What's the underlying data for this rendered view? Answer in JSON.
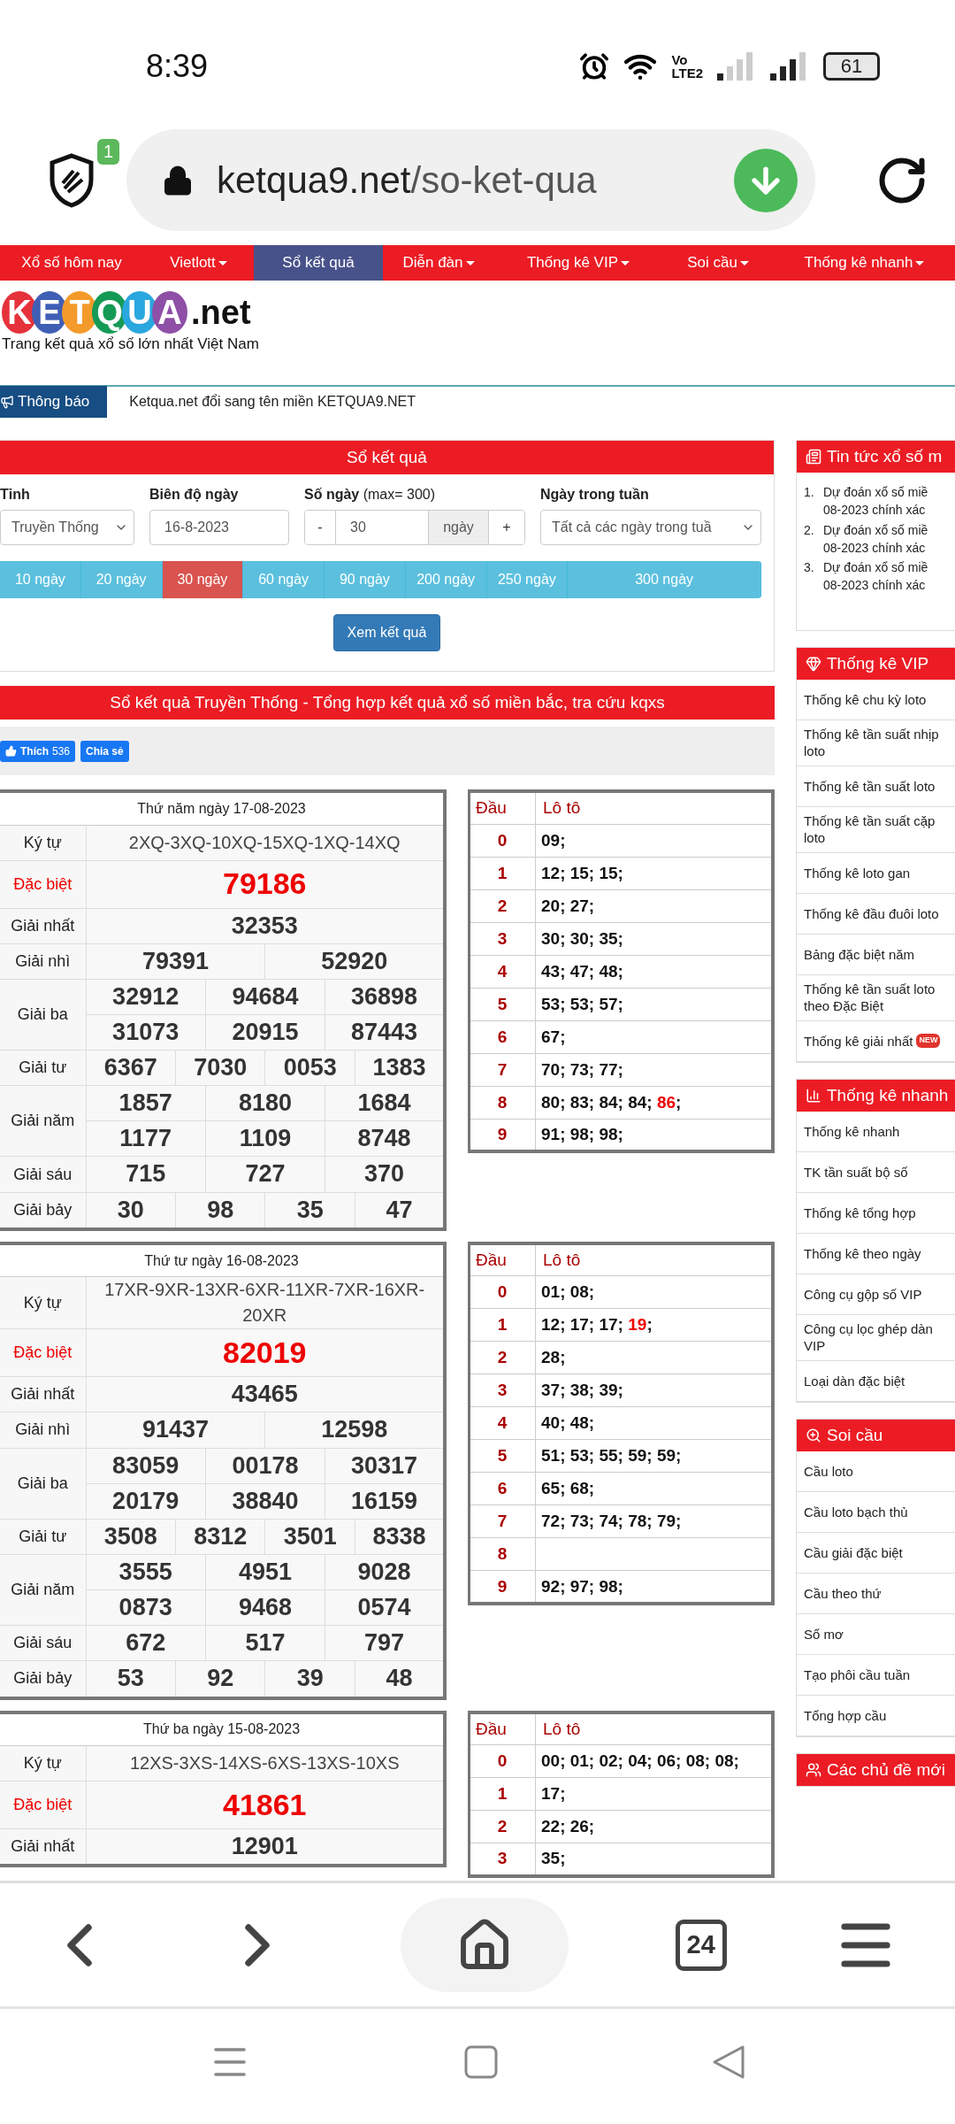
{
  "status_bar": {
    "time": "8:39",
    "volte": [
      "Vo",
      "LTE2"
    ],
    "battery": "61"
  },
  "browser": {
    "shield_badge": "1",
    "url_domain": "ketqua9.net",
    "url_path": "/so-ket-qua",
    "tab_count": "24"
  },
  "nav": [
    {
      "label": "Xổ số hôm nay",
      "has_menu": false,
      "selected": false
    },
    {
      "label": "Vietlott",
      "has_menu": true,
      "selected": false
    },
    {
      "label": "Sổ kết quả",
      "has_menu": false,
      "selected": true
    },
    {
      "label": "Diễn đàn",
      "has_menu": true,
      "selected": false
    },
    {
      "label": "Thống kê VIP",
      "has_menu": true,
      "selected": false
    },
    {
      "label": "Soi cầu",
      "has_menu": true,
      "selected": false
    },
    {
      "label": "Thống kê nhanh",
      "has_menu": true,
      "selected": false
    }
  ],
  "logo": {
    "letters": [
      {
        "char": "K",
        "color": "#e5323b"
      },
      {
        "char": "E",
        "color": "#3f5fb5"
      },
      {
        "char": "T",
        "color": "#f39a2b"
      },
      {
        "char": "Q",
        "color": "#159a55"
      },
      {
        "char": "U",
        "color": "#2aa7de"
      },
      {
        "char": "A",
        "color": "#8e4fa6"
      }
    ],
    "suffix": ".net",
    "tagline": "Trang kết quả xổ số lớn nhất Việt Nam"
  },
  "notice": {
    "label": "Thông báo",
    "text": "Ketqua.net đổi sang tên miền KETQUA9.NET"
  },
  "search_panel": {
    "title": "Sổ kết quả",
    "province": {
      "label": "Tỉnh",
      "value": "Truyền Thống"
    },
    "date_range": {
      "label": "Biên độ ngày",
      "value": "16-8-2023"
    },
    "days": {
      "label": "Số ngày",
      "hint": "(max= 300)",
      "minus": "-",
      "value": "30",
      "unit": "ngày",
      "plus": "+"
    },
    "weekday": {
      "label": "Ngày trong tuần",
      "value": "Tất cả các ngày trong tuầ"
    },
    "ranges": [
      {
        "label": "10 ngày",
        "selected": false
      },
      {
        "label": "20 ngày",
        "selected": false
      },
      {
        "label": "30 ngày",
        "selected": true
      },
      {
        "label": "60 ngày",
        "selected": false
      },
      {
        "label": "90 ngày",
        "selected": false
      },
      {
        "label": "200 ngày",
        "selected": false
      },
      {
        "label": "250 ngày",
        "selected": false
      },
      {
        "label": "300 ngày",
        "selected": false
      }
    ],
    "submit": "Xem kết quả"
  },
  "results_heading": "Sổ kết quả Truyền Thống - Tổng hợp kết quả xổ số miền bắc, tra cứu kqxs",
  "social": {
    "like": "Thích",
    "like_count": "536",
    "share": "Chia sẻ"
  },
  "draws": [
    {
      "date": "Thứ năm ngày 17-08-2023",
      "prizes": [
        {
          "kind": "code",
          "label": "Ký tự",
          "lines": [
            [
              "2XQ-3XQ-10XQ-15XQ-1XQ-14XQ"
            ]
          ]
        },
        {
          "kind": "special",
          "label": "Đặc biệt",
          "lines": [
            [
              "79186"
            ]
          ]
        },
        {
          "kind": "normal",
          "label": "Giải nhất",
          "lines": [
            [
              "32353"
            ]
          ]
        },
        {
          "kind": "normal",
          "label": "Giải nhì",
          "lines": [
            [
              "79391",
              "52920"
            ]
          ]
        },
        {
          "kind": "normal",
          "label": "Giải ba",
          "lines": [
            [
              "32912",
              "94684",
              "36898"
            ],
            [
              "31073",
              "20915",
              "87443"
            ]
          ]
        },
        {
          "kind": "normal",
          "label": "Giải tư",
          "lines": [
            [
              "6367",
              "7030",
              "0053",
              "1383"
            ]
          ]
        },
        {
          "kind": "normal",
          "label": "Giải năm",
          "lines": [
            [
              "1857",
              "8180",
              "1684"
            ],
            [
              "1177",
              "1109",
              "8748"
            ]
          ]
        },
        {
          "kind": "normal",
          "label": "Giải sáu",
          "lines": [
            [
              "715",
              "727",
              "370"
            ]
          ]
        },
        {
          "kind": "normal",
          "label": "Giải bảy",
          "lines": [
            [
              "30",
              "98",
              "35",
              "47"
            ]
          ]
        }
      ],
      "lotto": {
        "head_label": "Đầu",
        "numbers_label": "Lô tô",
        "rows": [
          {
            "head": "0",
            "text": "09;"
          },
          {
            "head": "1",
            "text": "12; 15; 15;"
          },
          {
            "head": "2",
            "text": "20; 27;"
          },
          {
            "head": "3",
            "text": "30; 30; 35;"
          },
          {
            "head": "4",
            "text": "43; 47; 48;"
          },
          {
            "head": "5",
            "text": "53; 53; 57;"
          },
          {
            "head": "6",
            "text": "67;"
          },
          {
            "head": "7",
            "text": "70; 73; 77;"
          },
          {
            "head": "8",
            "text": "80; 83; 84; 84;",
            "special": "86",
            "after": ";"
          },
          {
            "head": "9",
            "text": "91; 98; 98;"
          }
        ]
      }
    },
    {
      "date": "Thứ tư ngày 16-08-2023",
      "prizes": [
        {
          "kind": "code",
          "label": "Ký tự",
          "lines": [
            [
              "17XR-9XR-13XR-6XR-11XR-7XR-16XR-20XR"
            ]
          ]
        },
        {
          "kind": "special",
          "label": "Đặc biệt",
          "lines": [
            [
              "82019"
            ]
          ]
        },
        {
          "kind": "normal",
          "label": "Giải nhất",
          "lines": [
            [
              "43465"
            ]
          ]
        },
        {
          "kind": "normal",
          "label": "Giải nhì",
          "lines": [
            [
              "91437",
              "12598"
            ]
          ]
        },
        {
          "kind": "normal",
          "label": "Giải ba",
          "lines": [
            [
              "83059",
              "00178",
              "30317"
            ],
            [
              "20179",
              "38840",
              "16159"
            ]
          ]
        },
        {
          "kind": "normal",
          "label": "Giải tư",
          "lines": [
            [
              "3508",
              "8312",
              "3501",
              "8338"
            ]
          ]
        },
        {
          "kind": "normal",
          "label": "Giải năm",
          "lines": [
            [
              "3555",
              "4951",
              "9028"
            ],
            [
              "0873",
              "9468",
              "0574"
            ]
          ]
        },
        {
          "kind": "normal",
          "label": "Giải sáu",
          "lines": [
            [
              "672",
              "517",
              "797"
            ]
          ]
        },
        {
          "kind": "normal",
          "label": "Giải bảy",
          "lines": [
            [
              "53",
              "92",
              "39",
              "48"
            ]
          ]
        }
      ],
      "lotto": {
        "head_label": "Đầu",
        "numbers_label": "Lô tô",
        "rows": [
          {
            "head": "0",
            "text": "01; 08;"
          },
          {
            "head": "1",
            "text": "12; 17; 17;",
            "special": "19",
            "after": ";"
          },
          {
            "head": "2",
            "text": "28;"
          },
          {
            "head": "3",
            "text": "37; 38; 39;"
          },
          {
            "head": "4",
            "text": "40; 48;"
          },
          {
            "head": "5",
            "text": "51; 53; 55; 59; 59;"
          },
          {
            "head": "6",
            "text": "65; 68;"
          },
          {
            "head": "7",
            "text": "72; 73; 74; 78; 79;"
          },
          {
            "head": "8",
            "text": ""
          },
          {
            "head": "9",
            "text": "92; 97; 98;"
          }
        ]
      }
    },
    {
      "date": "Thứ ba ngày 15-08-2023",
      "prizes": [
        {
          "kind": "code",
          "label": "Ký tự",
          "lines": [
            [
              "12XS-3XS-14XS-6XS-13XS-10XS"
            ]
          ]
        },
        {
          "kind": "special",
          "label": "Đặc biệt",
          "lines": [
            [
              "41861"
            ]
          ]
        },
        {
          "kind": "normal",
          "label": "Giải nhất",
          "lines": [
            [
              "12901"
            ]
          ]
        }
      ],
      "lotto": {
        "head_label": "Đầu",
        "numbers_label": "Lô tô",
        "rows": [
          {
            "head": "0",
            "text": "00; 01; 02; 04; 06; 08; 08;"
          },
          {
            "head": "1",
            "text": "17;"
          },
          {
            "head": "2",
            "text": "22; 26;"
          },
          {
            "head": "3",
            "text": "35;"
          }
        ]
      }
    }
  ],
  "sidebar": [
    {
      "kind": "news",
      "title": "Tin tức xổ số m",
      "items": [
        {
          "number": "1.",
          "lines": [
            "Dự đoán xổ số miề",
            "08-2023 chính xác"
          ]
        },
        {
          "number": "2.",
          "lines": [
            "Dự đoán xổ số miề",
            "08-2023 chính xác"
          ]
        },
        {
          "number": "3.",
          "lines": [
            "Dự đoán xổ số miề",
            "08-2023 chính xác"
          ]
        }
      ]
    },
    {
      "kind": "links",
      "title": "Thống kê VIP",
      "items": [
        {
          "text": "Thống kê chu kỳ loto"
        },
        {
          "text": "Thống kê tần suất nhịp loto"
        },
        {
          "text": "Thống kê tần suất loto"
        },
        {
          "text": "Thống kê tần suất cặp loto"
        },
        {
          "text": "Thống kê loto gan"
        },
        {
          "text": "Thống kê đầu đuôi loto"
        },
        {
          "text": "Bảng đặc biệt năm"
        },
        {
          "text": "Thống kê tần suất loto theo Đặc Biệt"
        },
        {
          "text": "Thống kê giải nhất",
          "badge": "NEW"
        }
      ]
    },
    {
      "kind": "links",
      "title": "Thống kê nhanh",
      "items": [
        {
          "text": "Thống kê nhanh"
        },
        {
          "text": "TK tần suất bộ số"
        },
        {
          "text": "Thống kê tổng hợp"
        },
        {
          "text": "Thống kê theo ngày"
        },
        {
          "text": "Công cụ gộp số VIP"
        },
        {
          "text": "Công cụ lọc ghép dàn VIP"
        },
        {
          "text": "Loại dàn đặc biệt"
        }
      ]
    },
    {
      "kind": "links",
      "title": "Soi cầu",
      "items": [
        {
          "text": "Cầu loto"
        },
        {
          "text": "Cầu loto bạch thủ"
        },
        {
          "text": "Cầu giải đặc biệt"
        },
        {
          "text": "Cầu theo thứ"
        },
        {
          "text": "Sổ mơ"
        },
        {
          "text": "Tạo phôi cầu tuần"
        },
        {
          "text": "Tổng hợp cầu"
        }
      ]
    },
    {
      "kind": "header",
      "title": "Các chủ đề mới"
    }
  ]
}
